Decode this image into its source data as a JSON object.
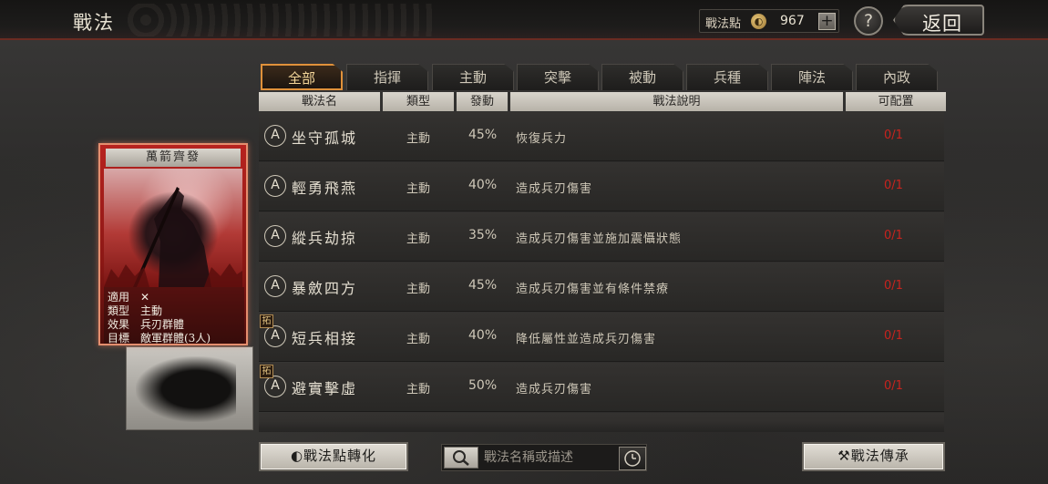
{
  "header": {
    "title": "戰法",
    "points_label": "戰法點",
    "points_value": "967",
    "plus_label": "+",
    "help_label": "?",
    "back_label": "返回"
  },
  "tabs": [
    {
      "label": "全部",
      "active": true
    },
    {
      "label": "指揮",
      "active": false
    },
    {
      "label": "主動",
      "active": false
    },
    {
      "label": "突擊",
      "active": false
    },
    {
      "label": "被動",
      "active": false
    },
    {
      "label": "兵種",
      "active": false
    },
    {
      "label": "陣法",
      "active": false
    },
    {
      "label": "內政",
      "active": false
    }
  ],
  "columns": [
    "戰法名",
    "類型",
    "發動",
    "戰法說明",
    "可配置"
  ],
  "rows": [
    {
      "badge": "A",
      "name": "坐守孤城",
      "type": "主動",
      "rate": "45%",
      "desc": "恢復兵力",
      "cfg": "0/1",
      "tag": ""
    },
    {
      "badge": "A",
      "name": "輕勇飛燕",
      "type": "主動",
      "rate": "40%",
      "desc": "造成兵刃傷害",
      "cfg": "0/1",
      "tag": ""
    },
    {
      "badge": "A",
      "name": "縱兵劫掠",
      "type": "主動",
      "rate": "35%",
      "desc": "造成兵刃傷害並施加震懾狀態",
      "cfg": "0/1",
      "tag": ""
    },
    {
      "badge": "A",
      "name": "暴斂四方",
      "type": "主動",
      "rate": "45%",
      "desc": "造成兵刃傷害並有條件禁療",
      "cfg": "0/1",
      "tag": ""
    },
    {
      "badge": "A",
      "name": "短兵相接",
      "type": "主動",
      "rate": "40%",
      "desc": "降低屬性並造成兵刃傷害",
      "cfg": "0/1",
      "tag": "拓"
    },
    {
      "badge": "A",
      "name": "避實擊虛",
      "type": "主動",
      "rate": "50%",
      "desc": "造成兵刃傷害",
      "cfg": "0/1",
      "tag": "拓"
    }
  ],
  "card": {
    "title": "萬箭齊發",
    "fields": [
      {
        "key": "適用",
        "value": "✕"
      },
      {
        "key": "類型",
        "value": "主動"
      },
      {
        "key": "效果",
        "value": "兵刃群體"
      },
      {
        "key": "目標",
        "value": "敵軍群體(3人)"
      }
    ]
  },
  "bottom": {
    "convert_label": "戰法點轉化",
    "search_placeholder": "戰法名稱或描述",
    "inherit_label": "戰法傳承"
  },
  "colors": {
    "accent_tab": "#e0913a",
    "config_red": "#c8231e",
    "card_red": "#b7231f"
  }
}
